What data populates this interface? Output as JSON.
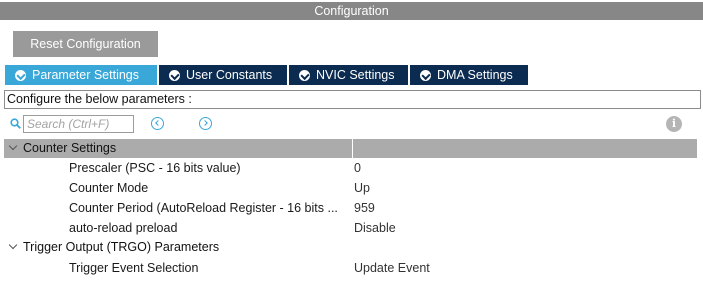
{
  "window": {
    "title": "Configuration"
  },
  "toolbar": {
    "reset_label": "Reset Configuration"
  },
  "tabs": [
    {
      "label": "Parameter Settings",
      "active": true
    },
    {
      "label": "User Constants",
      "active": false
    },
    {
      "label": "NVIC Settings",
      "active": false
    },
    {
      "label": "DMA Settings",
      "active": false
    }
  ],
  "description": "Configure the below parameters :",
  "search": {
    "placeholder": "Search (Ctrl+F)"
  },
  "groups": [
    {
      "label": "Counter Settings",
      "expanded": true,
      "params": [
        {
          "name": "Prescaler (PSC - 16 bits value)",
          "value": "0"
        },
        {
          "name": "Counter Mode",
          "value": "Up"
        },
        {
          "name": "Counter Period (AutoReload Register - 16 bits ...",
          "value": "959"
        },
        {
          "name": "auto-reload preload",
          "value": "Disable"
        }
      ]
    },
    {
      "label": "Trigger Output (TRGO) Parameters",
      "expanded": true,
      "params": [
        {
          "name": "Trigger Event Selection",
          "value": "Update Event"
        }
      ]
    }
  ],
  "colors": {
    "active_tab": "#3aa7d9",
    "inactive_tab": "#0b2b50",
    "title_bar": "#878787",
    "selected_row": "#ababab"
  }
}
